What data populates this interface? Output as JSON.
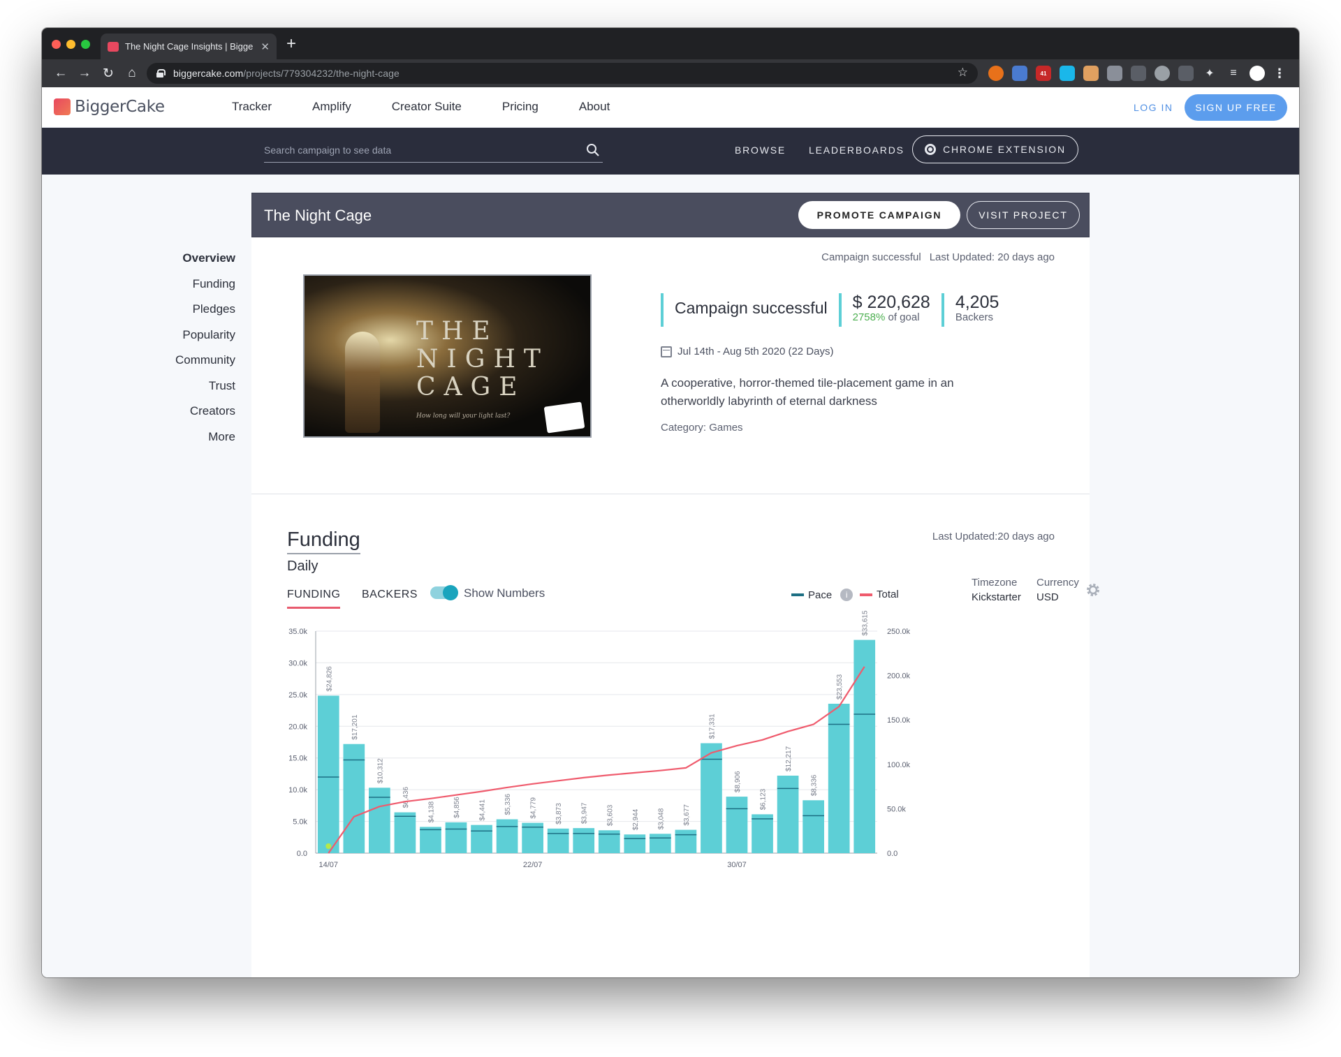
{
  "browser": {
    "tab_title": "The Night Cage Insights | Bigge",
    "url_host": "biggercake.com",
    "url_path": "/projects/779304232/the-night-cage",
    "nav": {
      "back": "←",
      "forward": "→",
      "reload": "↻",
      "home": "⌂",
      "star": "☆",
      "close": "✕",
      "new_tab": "+",
      "menu": "⋮"
    },
    "extension_badge": "41"
  },
  "site": {
    "logo_text": "BiggerCake",
    "nav": [
      "Tracker",
      "Amplify",
      "Creator Suite",
      "Pricing",
      "About"
    ],
    "login": "LOG IN",
    "signup": "SIGN UP FREE"
  },
  "subnav": {
    "search_placeholder": "Search campaign to see data",
    "browse": "BROWSE",
    "leaderboards": "LEADERBOARDS",
    "chrome_extension": "CHROME EXTENSION"
  },
  "project": {
    "title": "The Night Cage",
    "promote": "PROMOTE CAMPAIGN",
    "visit": "VISIT PROJECT",
    "status_top": "Campaign successful",
    "last_updated_top": "Last Updated: 20 days ago",
    "image_title_lines": [
      "THE",
      "NIGHT",
      "CAGE"
    ],
    "image_tagline": "How long will your light last?",
    "status": "Campaign successful",
    "amount": "$ 220,628",
    "goal_percent": "2758%",
    "goal_text": " of goal",
    "backers_count": "4,205",
    "backers_label": "Backers",
    "dates": "Jul 14th - Aug 5th 2020 (22 Days)",
    "description": "A cooperative, horror-themed tile-placement game in an otherworldly labyrinth of eternal darkness",
    "category": "Category: Games"
  },
  "sidenav": [
    "Overview",
    "Funding",
    "Pledges",
    "Popularity",
    "Community",
    "Trust",
    "Creators",
    "More"
  ],
  "funding": {
    "title": "Funding",
    "subtitle": "Daily",
    "last_updated": "Last Updated:20 days ago",
    "tab_funding": "FUNDING",
    "tab_backers": "BACKERS",
    "show_numbers": "Show Numbers",
    "legend_pace": "Pace",
    "legend_total": "Total",
    "info_glyph": "i",
    "timezone_label": "Timezone",
    "timezone_value": "Kickstarter",
    "currency_label": "Currency",
    "currency_value": "USD"
  },
  "colors": {
    "bar": "#5dcfd6",
    "pace": "#1d6f83",
    "total": "#ef5b6d",
    "accent": "#5c9ded"
  },
  "chart_data": {
    "type": "bar",
    "categories": [
      "14/07",
      "15/07",
      "16/07",
      "17/07",
      "18/07",
      "19/07",
      "20/07",
      "21/07",
      "22/07",
      "23/07",
      "24/07",
      "25/07",
      "26/07",
      "27/07",
      "28/07",
      "29/07",
      "30/07",
      "31/07",
      "01/08",
      "02/08",
      "03/08",
      "04/08"
    ],
    "x_tick_labels": [
      "14/07",
      "22/07",
      "30/07"
    ],
    "series": [
      {
        "name": "Funding",
        "axis": "left",
        "values": [
          24826,
          17201,
          10312,
          6436,
          4138,
          4856,
          4441,
          5336,
          4779,
          3873,
          3947,
          3603,
          2944,
          3048,
          3677,
          17331,
          8906,
          6123,
          12217,
          8336,
          23553,
          33615
        ]
      },
      {
        "name": "Pace",
        "axis": "left",
        "values": [
          12000,
          14700,
          8800,
          5800,
          3700,
          3800,
          3500,
          4200,
          4100,
          3100,
          3100,
          3000,
          2300,
          2400,
          2900,
          14800,
          7000,
          5400,
          10200,
          5900,
          20300,
          21900
        ]
      },
      {
        "name": "Total",
        "axis": "right",
        "values": [
          0,
          41000,
          52500,
          58000,
          61500,
          65500,
          69500,
          74000,
          78000,
          81500,
          85000,
          88000,
          90500,
          93000,
          96000,
          113000,
          121000,
          127500,
          137000,
          145000,
          165000,
          210000
        ]
      }
    ],
    "data_labels": [
      "$24,826",
      "$17,201",
      "$10,312",
      "$6,436",
      "$4,138",
      "$4,856",
      "$4,441",
      "$5,336",
      "$4,779",
      "$3,873",
      "$3,947",
      "$3,603",
      "$2,944",
      "$3,048",
      "$3,677",
      "$17,331",
      "$8,906",
      "$6,123",
      "$12,217",
      "$8,336",
      "$23,553",
      "$33,615"
    ],
    "y_left_ticks": [
      "0.0",
      "5.0k",
      "10.0k",
      "15.0k",
      "20.0k",
      "25.0k",
      "30.0k",
      "35.0k"
    ],
    "y_right_ticks": [
      "0.0",
      "50.0k",
      "100.0k",
      "150.0k",
      "200.0k",
      "250.0k"
    ],
    "ylim_left": [
      0,
      35000
    ],
    "ylim_right": [
      0,
      250000
    ],
    "grid": true
  }
}
